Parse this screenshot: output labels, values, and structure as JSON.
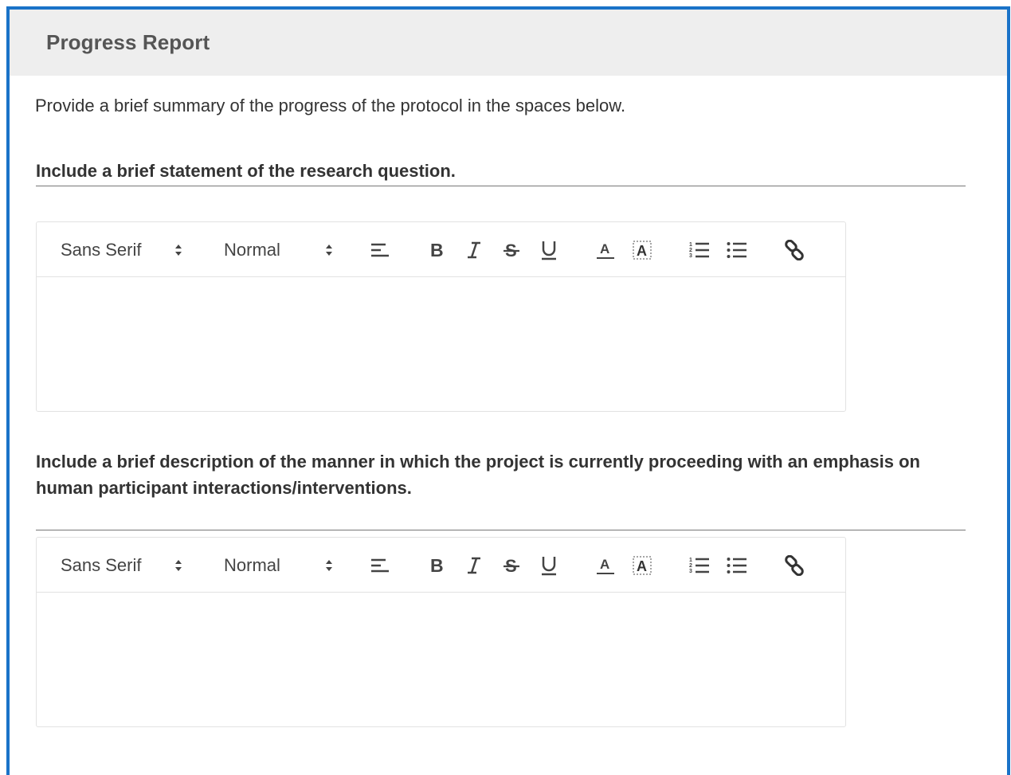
{
  "panel": {
    "title": "Progress Report"
  },
  "intro_text": "Provide a brief summary of the progress of the protocol in the spaces below.",
  "questions": [
    {
      "label": "Include a brief statement of the research question.",
      "editor": {
        "font": "Sans Serif",
        "size": "Normal",
        "content": ""
      }
    },
    {
      "label": "Include a brief description of the manner in which the project is currently proceeding with an emphasis on human participant interactions/interventions.",
      "editor": {
        "font": "Sans Serif",
        "size": "Normal",
        "content": ""
      }
    }
  ],
  "toolbar_icons": [
    "align-icon",
    "bold-icon",
    "italic-icon",
    "strikethrough-icon",
    "underline-icon",
    "text-color-icon",
    "background-color-icon",
    "ordered-list-icon",
    "bullet-list-icon",
    "link-icon"
  ],
  "colors": {
    "frame_border": "#1a73c8",
    "header_bg": "#eeeeee"
  }
}
